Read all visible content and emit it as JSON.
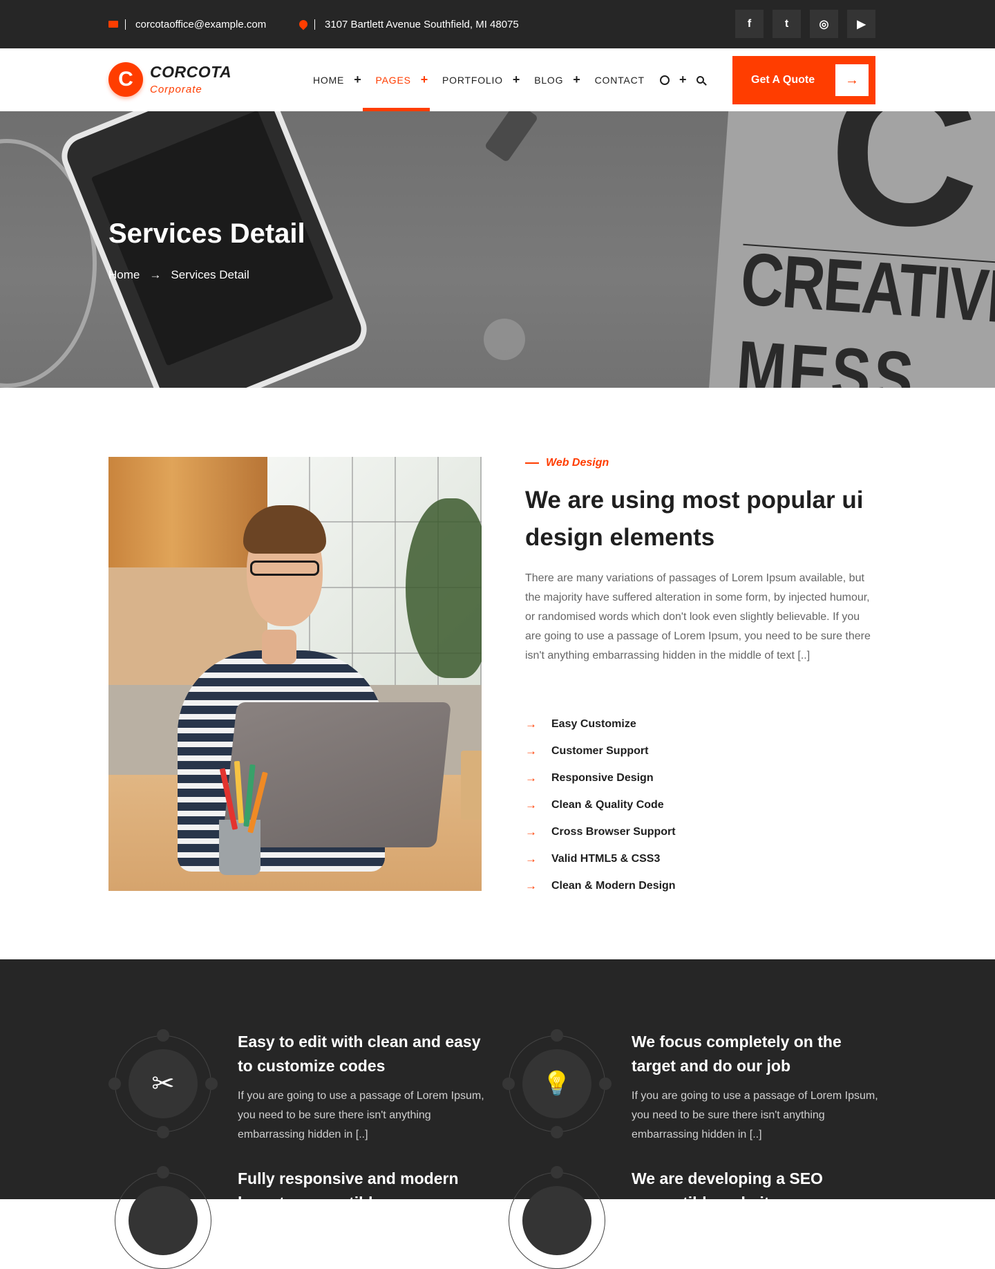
{
  "topbar": {
    "email": "corcotaoffice@example.com",
    "address": "3107 Bartlett Avenue Southfield, MI 48075",
    "social_icons": [
      "facebook-icon",
      "twitter-icon",
      "instagram-icon",
      "youtube-icon"
    ],
    "social_glyphs": [
      "f",
      "t",
      "◎",
      "▶"
    ]
  },
  "header": {
    "logo_letter": "C",
    "logo_name": "CORCOTA",
    "logo_sub": "Corporate",
    "nav": [
      {
        "label": "HOME",
        "has_plus": true
      },
      {
        "label": "PAGES",
        "has_plus": true,
        "active": true
      },
      {
        "label": "PORTFOLIO",
        "has_plus": true
      },
      {
        "label": "BLOG",
        "has_plus": true
      },
      {
        "label": "CONTACT",
        "has_plus": false
      }
    ],
    "plus_glyph": "+",
    "cta_label": "Get A Quote",
    "cta_arrow": "→"
  },
  "hero": {
    "title": "Services Detail",
    "breadcrumb_home": "Home",
    "breadcrumb_arrow": "→",
    "breadcrumb_current": "Services Detail",
    "bg_word": "CREATIVE",
    "bg_word2": "MESS",
    "bg_letter": "C"
  },
  "detail": {
    "kicker": "Web Design",
    "headline": "We are using most popular ui design elements",
    "paragraph": "There are many variations of passages of Lorem Ipsum available, but the majority have suffered alteration in some form, by injected humour, or randomised words which don't look even slightly believable. If you are going to use a passage of Lorem Ipsum, you need to be sure there isn't anything embarrassing hidden in the middle of text [..]",
    "arrow": "→",
    "features": [
      "Easy Customize",
      "Customer Support",
      "Responsive Design",
      "Clean & Quality Code",
      "Cross Browser Support",
      "Valid HTML5 & CSS3",
      "Clean & Modern Design"
    ]
  },
  "highlights": [
    {
      "icon": "tools-icon",
      "glyph": "✂",
      "title": "Easy to edit with clean and easy to customize codes",
      "text": "If you are going to use a passage of Lorem Ipsum, you need to be sure there isn't anything embarrassing hidden in [..]"
    },
    {
      "icon": "lightbulb-brain-icon",
      "glyph": "💡",
      "title": "We focus completely on the target and do our job",
      "text": "If you are going to use a passage of Lorem Ipsum, you need to be sure there isn't anything embarrassing hidden in [..]"
    },
    {
      "icon": "responsive-icon",
      "glyph": "",
      "title": "Fully responsive and modern layouts compatible",
      "text": ""
    },
    {
      "icon": "seo-icon",
      "glyph": "",
      "title": "We are developing a SEO compatible websites",
      "text": ""
    }
  ],
  "colors": {
    "accent": "#ff3d00",
    "dark": "#262626",
    "text": "#1f1f1f",
    "muted": "#666666"
  }
}
